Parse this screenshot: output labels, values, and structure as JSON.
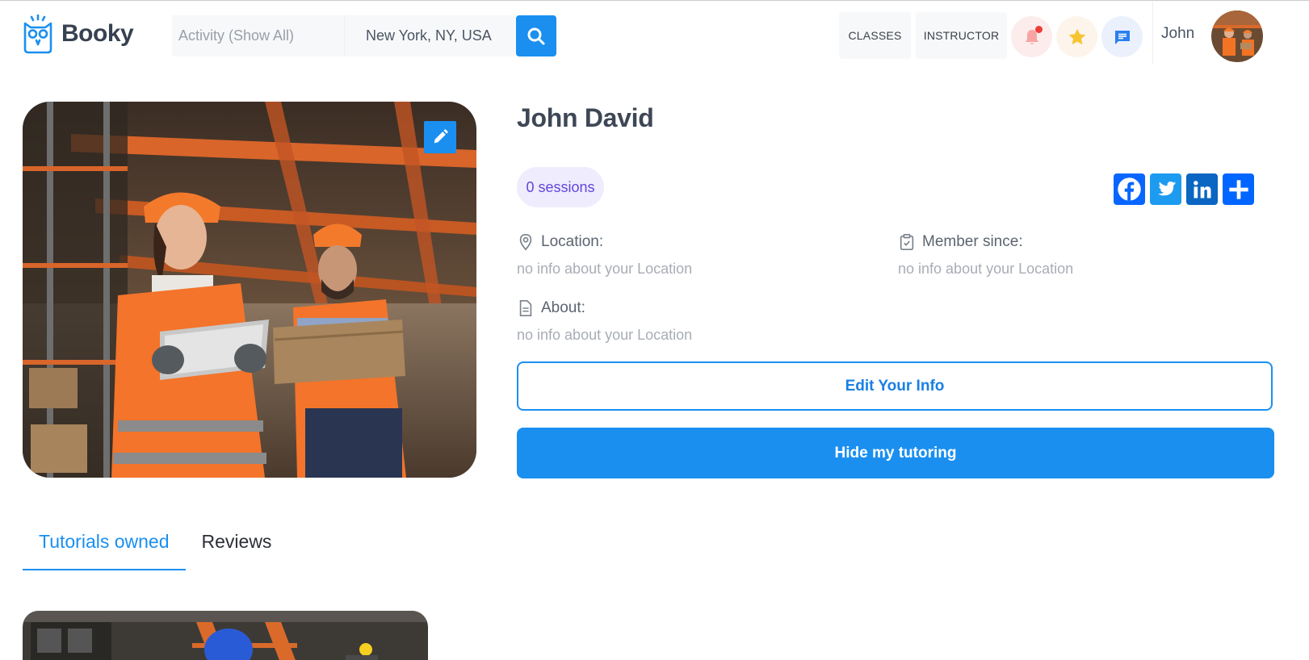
{
  "header": {
    "brand": "Booky",
    "search": {
      "activity_placeholder": "Activity (Show All)",
      "location_value": "New York, NY, USA"
    },
    "nav": {
      "classes_label": "CLASSES",
      "instructor_label": "INSTRUCTOR"
    },
    "icons": [
      "bell-icon",
      "star-icon",
      "chat-icon"
    ],
    "user_name": "John"
  },
  "profile": {
    "name": "John David",
    "sessions_label": "0 sessions",
    "share": [
      "facebook",
      "twitter",
      "linkedin",
      "share"
    ],
    "location_label": "Location:",
    "location_value": "no info about your Location",
    "member_since_label": "Member since:",
    "member_since_value": "no info about your Location",
    "about_label": "About:",
    "about_value": "no info about your Location",
    "edit_info_label": "Edit Your Info",
    "hide_tutoring_label": "Hide my tutoring"
  },
  "tabs": [
    {
      "label": "Tutorials owned",
      "active": true
    },
    {
      "label": "Reviews",
      "active": false
    }
  ],
  "colors": {
    "primary": "#1a8ff0",
    "badge_bg": "#efecfd",
    "badge_text": "#6247d8",
    "facebook": "#0866ff",
    "twitter": "#1d9bf0",
    "linkedin": "#0a66c2"
  }
}
